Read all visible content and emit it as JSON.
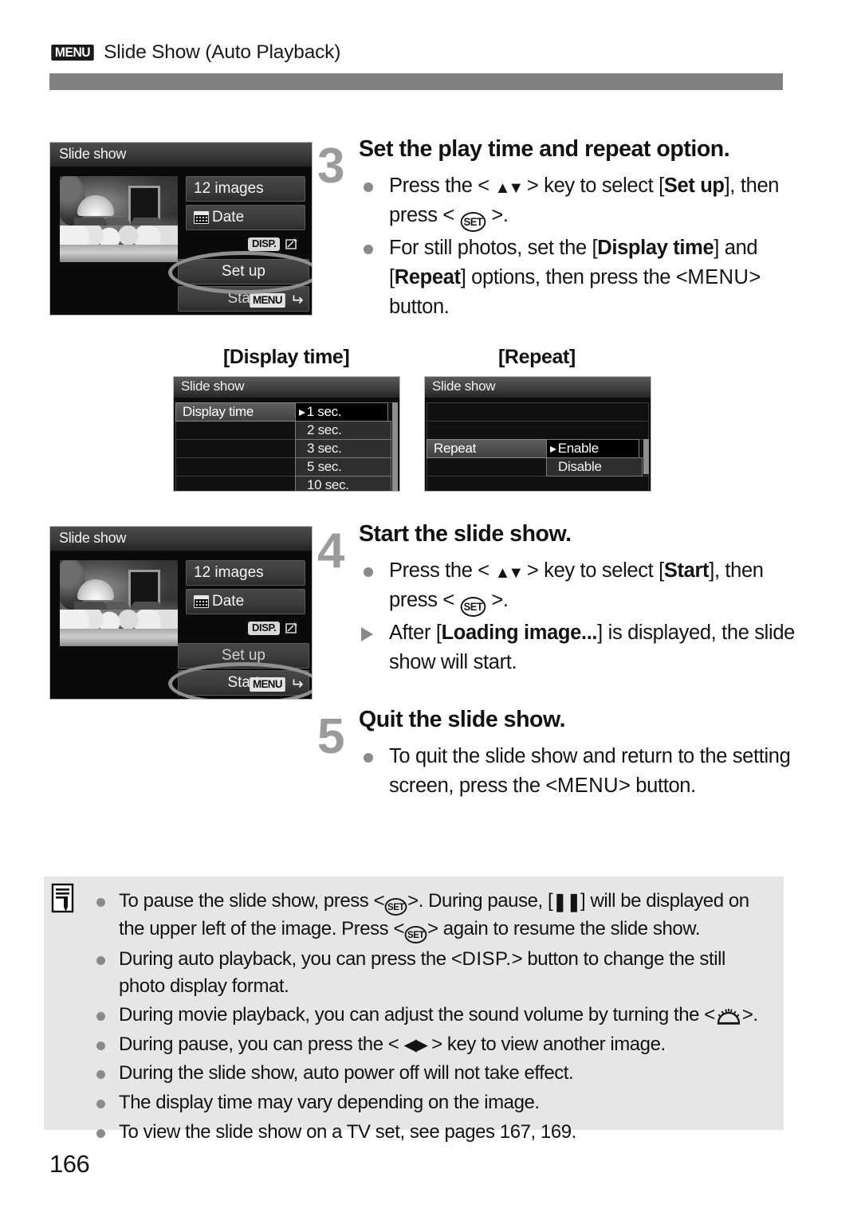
{
  "header": {
    "menu_badge": "MENU",
    "title": "Slide Show (Auto Playback)"
  },
  "camera_screens": {
    "setup": {
      "title": "Slide show",
      "count_label": "12 images",
      "date_label": "Date",
      "disp_badge": "DISP.",
      "setup_label": "Set up",
      "start_label": "Start",
      "menu_badge": "MENU",
      "return_glyph": "↩",
      "highlighted": "Set up"
    },
    "start": {
      "title": "Slide show",
      "count_label": "12 images",
      "date_label": "Date",
      "disp_badge": "DISP.",
      "setup_label": "Set up",
      "start_label": "Start",
      "menu_badge": "MENU",
      "return_glyph": "↩",
      "highlighted": "Start"
    }
  },
  "sub_screens": {
    "display_time": {
      "caption": "[Display time]",
      "screen_title": "Slide show",
      "setting_label": "Display time",
      "options": [
        "1 sec.",
        "2 sec.",
        "3 sec.",
        "5 sec.",
        "10 sec."
      ],
      "selected": "1 sec."
    },
    "repeat": {
      "caption": "[Repeat]",
      "screen_title": "Slide show",
      "setting_label": "Repeat",
      "options": [
        "Enable",
        "Disable"
      ],
      "selected": "Enable"
    }
  },
  "steps": [
    {
      "number": "3",
      "heading": "Set the play time and repeat option.",
      "bullets": [
        {
          "marker": "dot",
          "parts": [
            {
              "t": "Press the < ",
              "b": false
            },
            {
              "t": "▲▼",
              "b": false,
              "glyph": "updown"
            },
            {
              "t": " > key to select [",
              "b": false
            },
            {
              "t": "Set up",
              "b": true
            },
            {
              "t": "], then press < ",
              "b": false
            },
            {
              "t": "SET",
              "b": false,
              "glyph": "setbtn"
            },
            {
              "t": " >.",
              "b": false
            }
          ]
        },
        {
          "marker": "dot",
          "parts": [
            {
              "t": "For still photos, set the [",
              "b": false
            },
            {
              "t": "Display time",
              "b": true
            },
            {
              "t": "] and [",
              "b": false
            },
            {
              "t": "Repeat",
              "b": true
            },
            {
              "t": "] options, then press the <",
              "b": false
            },
            {
              "t": "MENU",
              "b": false,
              "glyph": "menuword"
            },
            {
              "t": "> button.",
              "b": false
            }
          ]
        }
      ]
    },
    {
      "number": "4",
      "heading": "Start the slide show.",
      "bullets": [
        {
          "marker": "dot",
          "parts": [
            {
              "t": "Press the < ",
              "b": false
            },
            {
              "t": "▲▼",
              "b": false,
              "glyph": "updown"
            },
            {
              "t": " > key to select [",
              "b": false
            },
            {
              "t": "Start",
              "b": true
            },
            {
              "t": "], then press < ",
              "b": false
            },
            {
              "t": "SET",
              "b": false,
              "glyph": "setbtn"
            },
            {
              "t": " >.",
              "b": false
            }
          ]
        },
        {
          "marker": "triangle",
          "parts": [
            {
              "t": "After [",
              "b": false
            },
            {
              "t": "Loading image...",
              "b": true
            },
            {
              "t": "] is displayed, the slide show will start.",
              "b": false
            }
          ]
        }
      ]
    },
    {
      "number": "5",
      "heading": "Quit the slide show.",
      "bullets": [
        {
          "marker": "dot",
          "parts": [
            {
              "t": "To quit the slide show and return to the setting screen, press the <",
              "b": false
            },
            {
              "t": "MENU",
              "b": false,
              "glyph": "menuword"
            },
            {
              "t": "> button.",
              "b": false
            }
          ]
        }
      ]
    }
  ],
  "notes": {
    "icon": "note-pencil-icon",
    "items": [
      {
        "parts": [
          {
            "t": "To pause the slide show, press <",
            "b": false
          },
          {
            "t": "SET",
            "b": false,
            "glyph": "setbtn-sm"
          },
          {
            "t": ">. During pause, [",
            "b": false
          },
          {
            "t": "❙❙",
            "b": false,
            "glyph": "pause"
          },
          {
            "t": "] will be displayed on the upper left of the image. Press <",
            "b": false
          },
          {
            "t": "SET",
            "b": false,
            "glyph": "setbtn-sm"
          },
          {
            "t": "> again to resume the slide show.",
            "b": false
          }
        ]
      },
      {
        "parts": [
          {
            "t": "During auto playback, you can press the <",
            "b": false
          },
          {
            "t": "DISP.",
            "b": false,
            "glyph": "dispword"
          },
          {
            "t": "> button to change the still photo display format.",
            "b": false
          }
        ]
      },
      {
        "parts": [
          {
            "t": "During movie playback, you can adjust the sound volume by turning the <",
            "b": false
          },
          {
            "t": "main-dial",
            "b": false,
            "glyph": "dial"
          },
          {
            "t": ">.",
            "b": false
          }
        ]
      },
      {
        "parts": [
          {
            "t": "During pause, you can press the < ",
            "b": false
          },
          {
            "t": "◀▶",
            "b": false,
            "glyph": "leftright"
          },
          {
            "t": " > key to view another image.",
            "b": false
          }
        ]
      },
      {
        "parts": [
          {
            "t": "During the slide show, auto power off will not take effect.",
            "b": false
          }
        ]
      },
      {
        "parts": [
          {
            "t": "The display time may vary depending on the image.",
            "b": false
          }
        ]
      },
      {
        "parts": [
          {
            "t": "To view the slide show on a TV set, see pages 167, 169.",
            "b": false
          }
        ]
      }
    ]
  },
  "page_number": "166",
  "colors": {
    "rule": "#808080",
    "step_number": "#9b9b9b",
    "bullet": "#8a8a8a",
    "notes_background": "#e6e6e6",
    "highlight_ellipse": "#8f8f8f"
  }
}
